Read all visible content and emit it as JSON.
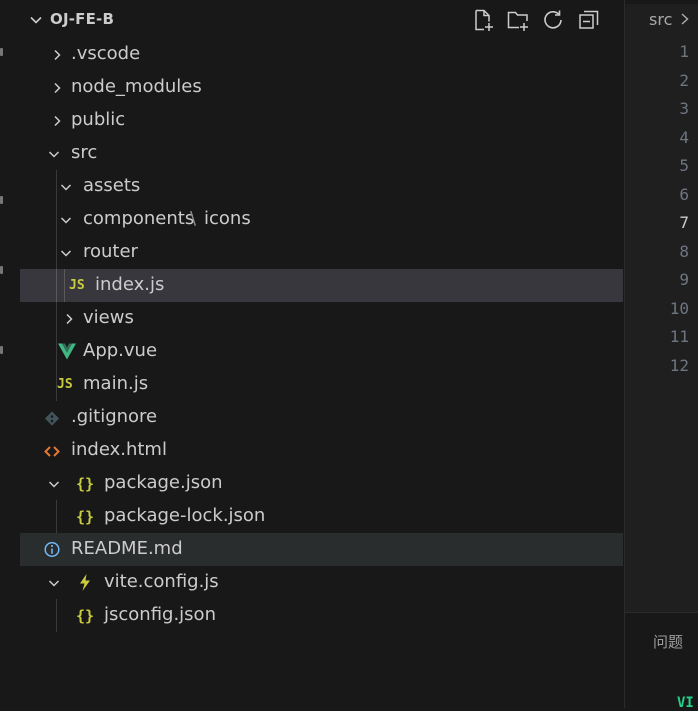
{
  "explorer": {
    "root_title": "OJ-FE-B",
    "actions": {
      "new_file_icon": "new-file-icon",
      "new_folder_icon": "new-folder-icon",
      "refresh_icon": "refresh-icon",
      "collapse_icon": "collapse-all-icon"
    },
    "tree": [
      {
        "label": ".vscode",
        "type": "folder",
        "expanded": false
      },
      {
        "label": "node_modules",
        "type": "folder",
        "expanded": false
      },
      {
        "label": "public",
        "type": "folder",
        "expanded": false
      },
      {
        "label": "src",
        "type": "folder",
        "expanded": true
      },
      {
        "label": "assets",
        "type": "folder",
        "expanded": true
      },
      {
        "label": "components",
        "type": "folder",
        "expanded": true
      },
      {
        "label": "icons",
        "type": "folder",
        "expanded": false
      },
      {
        "label": "router",
        "type": "folder",
        "expanded": true
      },
      {
        "label": "index.js",
        "type": "js-file",
        "icon_text": "JS",
        "selected": true
      },
      {
        "label": "views",
        "type": "folder",
        "expanded": false
      },
      {
        "label": "App.vue",
        "type": "vue-file"
      },
      {
        "label": "main.js",
        "type": "js-file",
        "icon_text": "JS"
      },
      {
        "label": ".gitignore",
        "type": "git-file"
      },
      {
        "label": "index.html",
        "type": "html-file",
        "icon_text": "<>"
      },
      {
        "label": "package.json",
        "type": "json-file",
        "icon_text": "{}",
        "expanded": true
      },
      {
        "label": "package-lock.json",
        "type": "json-file",
        "icon_text": "{}"
      },
      {
        "label": "README.md",
        "type": "info-file",
        "hovered": true
      },
      {
        "label": "vite.config.js",
        "type": "vite-file",
        "expanded": true
      },
      {
        "label": "jsconfig.json",
        "type": "json-file",
        "icon_text": "{}"
      }
    ]
  },
  "editor": {
    "breadcrumb": "src",
    "line_numbers": [
      "1",
      "2",
      "3",
      "4",
      "5",
      "6",
      "7",
      "8",
      "9",
      "10",
      "11",
      "12"
    ],
    "active_line": "7"
  },
  "panel": {
    "tab_label": "问题",
    "terminal_text": "VI"
  },
  "colors": {
    "sidebar_bg": "#181818",
    "selected_row_bg": "#37373d",
    "text": "#cccccc",
    "js_yellow": "#cbcb41",
    "vue_green": "#41b883",
    "html_orange": "#e37933",
    "info_blue": "#75beff",
    "terminal_green": "#23d18b"
  }
}
